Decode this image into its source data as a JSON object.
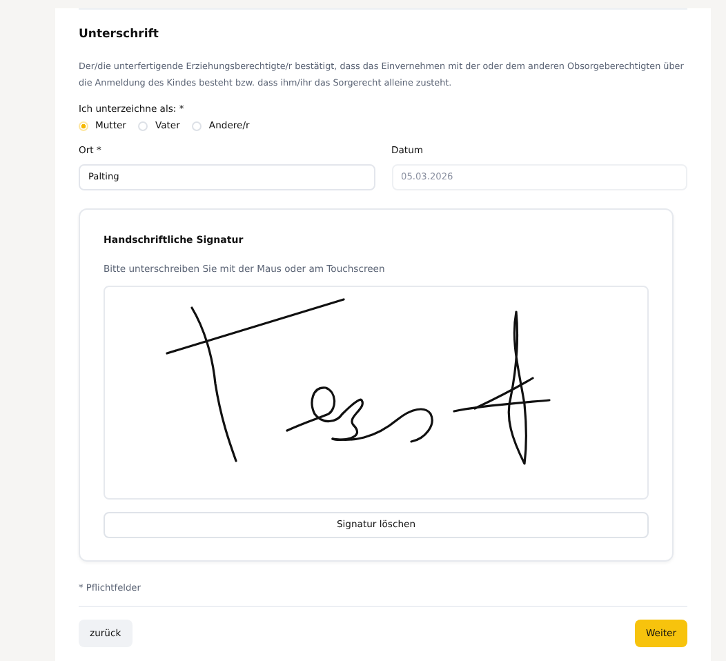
{
  "section": {
    "title": "Unterschrift",
    "text": "Der/die unterfertigende Erziehungsberechtigte/r bestätigt, dass das Einvernehmen mit der oder dem anderen Obsorgeberechtigten über die Anmeldung des Kindes besteht bzw. dass ihm/ihr das Sorgerecht alleine zusteht."
  },
  "role": {
    "label": "Ich unterzeichne als: *",
    "options": [
      {
        "label": "Mutter",
        "selected": true
      },
      {
        "label": "Vater",
        "selected": false
      },
      {
        "label": "Andere/r",
        "selected": false
      }
    ]
  },
  "fields": [
    {
      "label": "Ort *",
      "value": "Palting",
      "disabled": false
    },
    {
      "label": "Datum",
      "value": "05.03.2026",
      "disabled": true
    }
  ],
  "signature": {
    "title": "Handschriftliche Signatur",
    "hint": "Bitte unterschreiben Sie mit der Maus oder am Touchscreen",
    "clear_button": "Signatur löschen"
  },
  "required_note": "* Pflichtfelder",
  "buttons": [
    {
      "kind": "secondary",
      "label": "zurück"
    },
    {
      "kind": "primary",
      "label": "Weiter"
    }
  ]
}
